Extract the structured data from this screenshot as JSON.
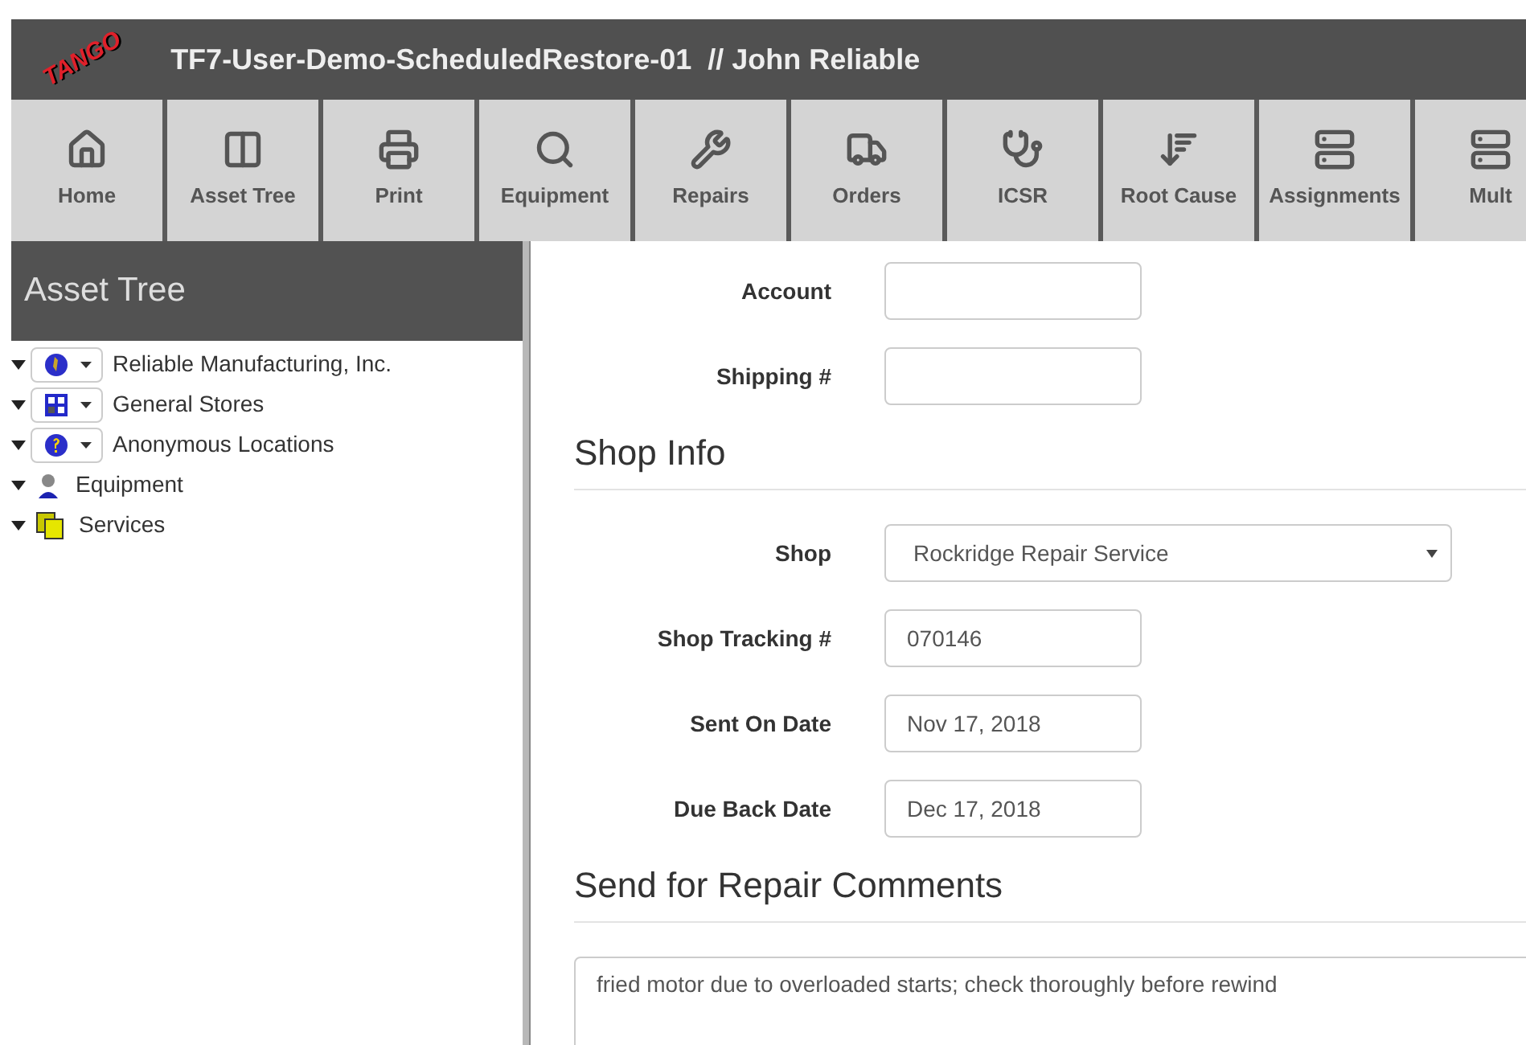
{
  "header": {
    "logo": "TANGO",
    "title": "TF7-User-Demo-ScheduledRestore-01  // John Reliable"
  },
  "toolbar": [
    {
      "label": "Home",
      "kind": "home"
    },
    {
      "label": "Asset Tree",
      "kind": "columns"
    },
    {
      "label": "Print",
      "kind": "print"
    },
    {
      "label": "Equipment",
      "kind": "search"
    },
    {
      "label": "Repairs",
      "kind": "wrench"
    },
    {
      "label": "Orders",
      "kind": "truck"
    },
    {
      "label": "ICSR",
      "kind": "stethoscope"
    },
    {
      "label": "Root Cause",
      "kind": "sort"
    },
    {
      "label": "Assignments",
      "kind": "list"
    },
    {
      "label": "Mult",
      "kind": "list"
    }
  ],
  "sidebar": {
    "title": "Asset Tree",
    "items": [
      {
        "label": "Reliable Manufacturing, Inc.",
        "kind": "globe",
        "dropdown": true,
        "expanded": true
      },
      {
        "label": "General Stores",
        "kind": "stores",
        "dropdown": true,
        "expanded": true
      },
      {
        "label": "Anonymous Locations",
        "kind": "question",
        "dropdown": true,
        "expanded": true
      },
      {
        "label": "Equipment",
        "kind": "person",
        "dropdown": false,
        "expanded": true
      },
      {
        "label": "Services",
        "kind": "pages",
        "dropdown": false,
        "expanded": true
      }
    ]
  },
  "form": {
    "top_fields": [
      {
        "label": "Account",
        "kind": "text"
      },
      {
        "label": "Shipping #",
        "kind": "text"
      }
    ],
    "sections": [
      {
        "heading": "Shop Info",
        "fields": [
          {
            "label": "Shop",
            "value": "Rockridge Repair Service",
            "kind": "select"
          },
          {
            "label": "Shop Tracking #",
            "value": "070146",
            "kind": "text"
          },
          {
            "label": "Sent On Date",
            "value": "Nov 17, 2018",
            "kind": "text"
          },
          {
            "label": "Due Back Date",
            "value": "Dec 17, 2018",
            "kind": "text"
          }
        ]
      },
      {
        "heading": "Send for Repair Comments",
        "fields": [
          {
            "value": "fried motor due to overloaded starts; check thoroughly before rewind",
            "kind": "textarea"
          }
        ]
      }
    ]
  }
}
